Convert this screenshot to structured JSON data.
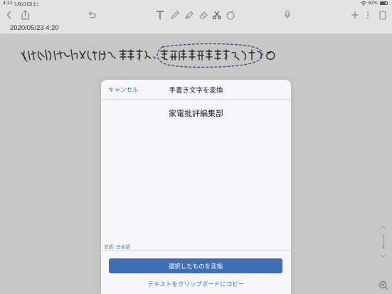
{
  "status_bar": {
    "time": "4:22",
    "date": "5月23日(土)",
    "battery": "82%"
  },
  "toolbar": {
    "left_icons": [
      "back-chevron-icon",
      "share-icon",
      "undo-icon"
    ],
    "center_icons": [
      "text-tool-icon",
      "pen-icon",
      "highlighter-icon",
      "eraser-icon",
      "lasso-scissors-icon",
      "color-picker-icon"
    ],
    "right_icons": [
      "microphone-icon",
      "add-icon",
      "more-icon",
      "page-view-icon"
    ]
  },
  "document": {
    "date": "2020/05/23 4:20",
    "handwriting": "お世話になっております。電選舎・家電批評編集部の"
  },
  "modal": {
    "cancel": "キャンセル",
    "title": "手書き文字を変換",
    "result": "家電批評編集部",
    "language_label": "言語:",
    "language_value": "日本語",
    "convert_button": "選択したものを変換",
    "copy_button": "テキストをクリップボードにコピー"
  },
  "side_nav": {
    "current_page": "1",
    "separator": "/",
    "total_pages": "2"
  },
  "colors": {
    "accent": "#3b74c5",
    "button": "#3e6fb6",
    "lasso": "#2e4a94"
  }
}
